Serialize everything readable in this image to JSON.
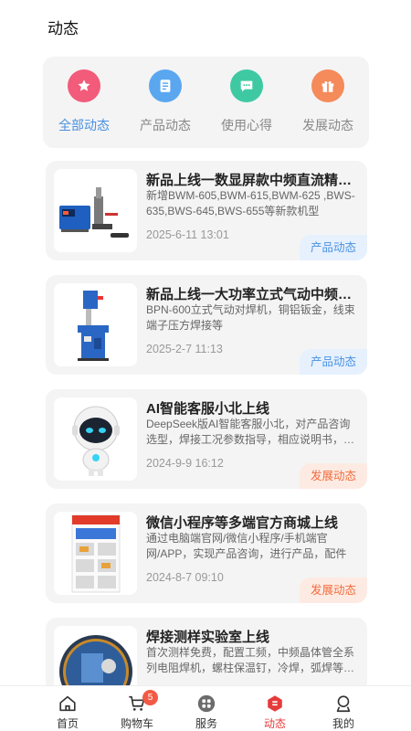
{
  "header": {
    "title": "动态"
  },
  "categories": [
    {
      "label": "全部动态",
      "icon": "star-badge-icon",
      "color": "#f25b7a",
      "active": true
    },
    {
      "label": "产品动态",
      "icon": "document-icon",
      "color": "#5aa7f0",
      "active": false
    },
    {
      "label": "使用心得",
      "icon": "chat-icon",
      "color": "#3ec9a3",
      "active": false
    },
    {
      "label": "发展动态",
      "icon": "gift-icon",
      "color": "#f58a5a",
      "active": false
    }
  ],
  "feed": [
    {
      "title": "新品上线一数显屏款中频直流精…",
      "desc": "新增BWM-605,BWM-615,BWM-625 ,BWS-635,BWS-645,BWS-655等新款机型",
      "date": "2025-6-11 13:01",
      "tag": "产品动态",
      "tag_color": "blue"
    },
    {
      "title": "新品上线一大功率立式气动中频…",
      "desc": "BPN-600立式气动对焊机，铜铝钣金，线束端子压方焊接等",
      "date": "2025-2-7 11:13",
      "tag": "产品动态",
      "tag_color": "blue"
    },
    {
      "title": "AI智能客服小北上线",
      "desc": "DeepSeek版AI智能客服小北，对产品咨询选型，焊接工况参数指导，相应说明书，…",
      "date": "2024-9-9 16:12",
      "tag": "发展动态",
      "tag_color": "orange"
    },
    {
      "title": "微信小程序等多端官方商城上线",
      "desc": "通过电脑端官网/微信小程序/手机端官网/APP，实现产品咨询，进行产品，配件耗…",
      "date": "2024-8-7 09:10",
      "tag": "发展动态",
      "tag_color": "orange"
    },
    {
      "title": "焊接测样实验室上线",
      "desc": "首次测样免费，配置工频，中频晶体管全系列电阻焊机，螺柱保温钉，冷焊，弧焊等…",
      "date": "",
      "tag": "",
      "tag_color": "blue"
    }
  ],
  "tabbar": {
    "items": [
      {
        "label": "首页",
        "icon": "home-icon"
      },
      {
        "label": "购物车",
        "icon": "cart-icon",
        "badge": "5"
      },
      {
        "label": "服务",
        "icon": "grid-icon"
      },
      {
        "label": "动态",
        "icon": "news-icon",
        "active": true
      },
      {
        "label": "我的",
        "icon": "profile-icon"
      }
    ]
  }
}
